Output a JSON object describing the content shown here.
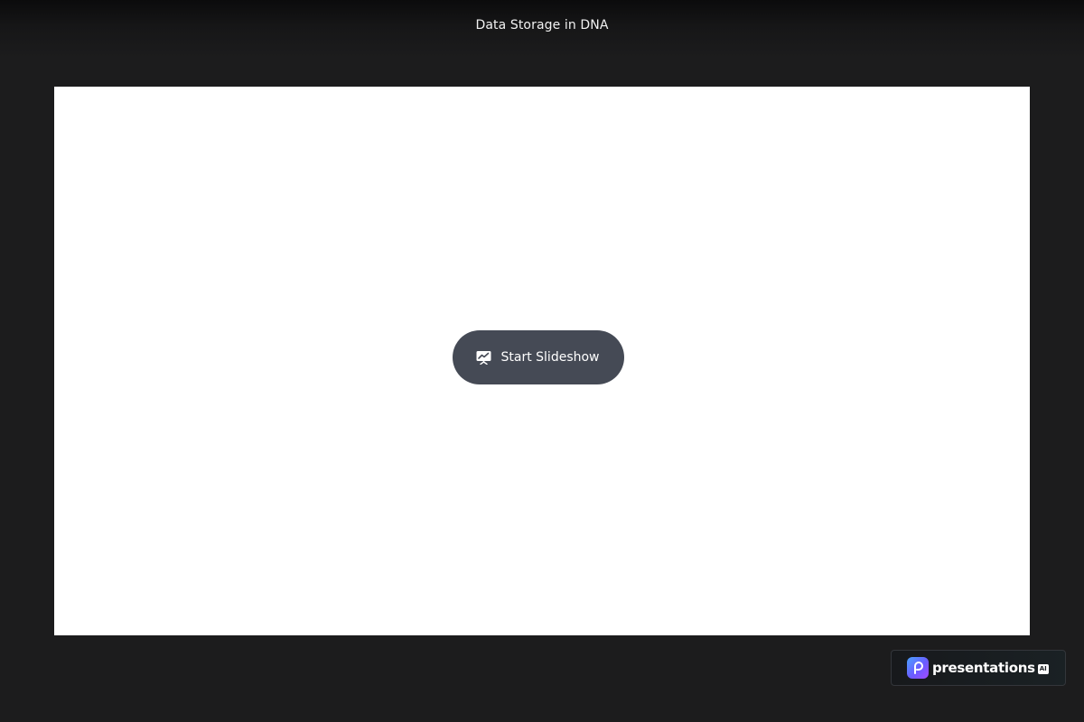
{
  "header": {
    "title": "Data Storage in DNA"
  },
  "slide": {
    "start_button": {
      "label": "Start Slideshow",
      "icon": "presentation-icon"
    }
  },
  "brand": {
    "name": "presentations",
    "suffix": "AI",
    "logo_icon": "presentations-logo-icon"
  },
  "colors": {
    "page_background": "#1c1c1d",
    "slide_background": "#ffffff",
    "button_background": "#454a55",
    "button_text": "#ffffff"
  }
}
